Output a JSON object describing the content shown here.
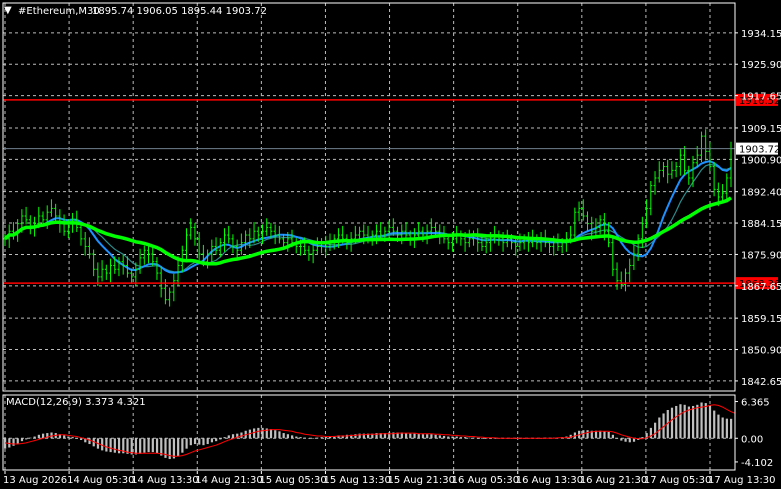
{
  "window": {
    "symbol_label": "#Ethereum,M30",
    "ohlc": "1895.74 1906.05 1895.44 1903.72"
  },
  "colors": {
    "background": "#000000",
    "candle": "#00ff00",
    "grid": "#bcbcbc",
    "axis_text": "#ffffff",
    "level_line": "#ff0000",
    "ma_fast": "#1e90ff",
    "ma_medium": "#2e8b8b",
    "ma_slow": "#00ff00",
    "histogram": "#c0c0c0",
    "signal": "#ff0000",
    "current_price_line": "#708090"
  },
  "chart_data": [
    {
      "type": "candlestick",
      "symbol": "#Ethereum",
      "timeframe": "M30",
      "ylim": [
        1840,
        1942
      ],
      "y_ticks": [
        "1934.15",
        "1925.90",
        "1917.65",
        "1909.15",
        "1900.90",
        "1892.40",
        "1884.15",
        "1875.90",
        "1867.65",
        "1859.15",
        "1850.90",
        "1842.65"
      ],
      "x_ticks": [
        "13 Aug 2026",
        "14 Aug 05:30",
        "14 Aug 13:30",
        "14 Aug 21:30",
        "15 Aug 05:30",
        "15 Aug 13:30",
        "15 Aug 21:30",
        "16 Aug 05:30",
        "16 Aug 13:30",
        "16 Aug 21:30",
        "17 Aug 05:30",
        "17 Aug 13:30"
      ],
      "levels": [
        {
          "value": 1916.52,
          "label": "1916.52"
        },
        {
          "value": 1868.36,
          "label": "1868.36"
        }
      ],
      "current_price": {
        "value": 1903.72,
        "label": "1903.72"
      },
      "close": [
        1880,
        1882,
        1881,
        1884,
        1886,
        1885,
        1883,
        1884,
        1886,
        1885,
        1887,
        1888,
        1886,
        1884,
        1882,
        1884,
        1885,
        1883,
        1880,
        1878,
        1876,
        1872,
        1870,
        1872,
        1871,
        1873,
        1872,
        1874,
        1873,
        1871,
        1870,
        1872,
        1875,
        1877,
        1876,
        1874,
        1871,
        1867,
        1864,
        1866,
        1869,
        1873,
        1877,
        1881,
        1883,
        1880,
        1876,
        1874,
        1876,
        1878,
        1877,
        1879,
        1881,
        1880,
        1878,
        1877,
        1879,
        1881,
        1880,
        1882,
        1881,
        1882,
        1883,
        1882,
        1881,
        1880,
        1879,
        1880,
        1879,
        1878,
        1878,
        1877,
        1876,
        1877,
        1878,
        1879,
        1878,
        1879,
        1880,
        1881,
        1880,
        1879,
        1880,
        1881,
        1882,
        1881,
        1880,
        1881,
        1882,
        1881,
        1882,
        1883,
        1882,
        1881,
        1882,
        1881,
        1880,
        1881,
        1882,
        1881,
        1882,
        1883,
        1882,
        1881,
        1880,
        1879,
        1880,
        1881,
        1880,
        1879,
        1880,
        1881,
        1879,
        1878,
        1879,
        1880,
        1881,
        1880,
        1879,
        1880,
        1879,
        1878,
        1879,
        1880,
        1879,
        1880,
        1879,
        1880,
        1879,
        1878,
        1879,
        1878,
        1879,
        1880,
        1881,
        1887,
        1888,
        1886,
        1884,
        1882,
        1883,
        1885,
        1882,
        1879,
        1872,
        1869,
        1868,
        1871,
        1873,
        1876,
        1880,
        1884,
        1888,
        1894,
        1896,
        1898,
        1899,
        1897,
        1898,
        1899,
        1902,
        1898,
        1896,
        1900,
        1902,
        1907,
        1903,
        1899,
        1893,
        1891,
        1892,
        1896,
        1903.72
      ]
    },
    {
      "type": "macd",
      "label": "MACD(12,26,9) 3.373 4.321",
      "ylim": [
        -5.5,
        7.5
      ],
      "y_ticks": [
        "6.365",
        "0.00",
        "-4.102"
      ],
      "histogram": [
        -1.8,
        -1.6,
        -1.3,
        -0.9,
        -0.5,
        -0.2,
        0.1,
        0.3,
        0.6,
        0.8,
        0.9,
        1.0,
        0.9,
        0.7,
        0.5,
        0.3,
        0.2,
        0.0,
        -0.3,
        -0.7,
        -1.0,
        -1.4,
        -1.8,
        -2.1,
        -2.3,
        -2.4,
        -2.5,
        -2.6,
        -2.6,
        -2.7,
        -2.8,
        -2.8,
        -2.7,
        -2.5,
        -2.4,
        -2.4,
        -2.6,
        -3.0,
        -3.4,
        -3.6,
        -3.5,
        -3.1,
        -2.5,
        -1.8,
        -1.2,
        -1.0,
        -1.1,
        -1.2,
        -1.0,
        -0.7,
        -0.5,
        -0.2,
        0.2,
        0.5,
        0.7,
        0.8,
        1.0,
        1.3,
        1.5,
        1.7,
        1.8,
        1.8,
        1.7,
        1.6,
        1.4,
        1.2,
        0.9,
        0.7,
        0.5,
        0.3,
        0.2,
        0.1,
        0.0,
        0.0,
        0.1,
        0.2,
        0.2,
        0.3,
        0.4,
        0.5,
        0.5,
        0.6,
        0.6,
        0.7,
        0.8,
        0.8,
        0.8,
        0.8,
        0.9,
        0.9,
        0.9,
        1.0,
        1.0,
        1.0,
        1.0,
        0.9,
        0.8,
        0.8,
        0.8,
        0.7,
        0.7,
        0.7,
        0.6,
        0.5,
        0.4,
        0.3,
        0.3,
        0.3,
        0.2,
        0.2,
        0.1,
        0.1,
        0.0,
        -0.1,
        -0.1,
        -0.1,
        0.0,
        0.0,
        0.0,
        0.0,
        0.0,
        -0.1,
        -0.1,
        -0.1,
        0.0,
        0.0,
        0.0,
        0.0,
        0.1,
        0.1,
        0.1,
        0.1,
        0.2,
        0.3,
        0.6,
        1.0,
        1.3,
        1.4,
        1.4,
        1.3,
        1.3,
        1.3,
        1.2,
        1.1,
        0.6,
        0.0,
        -0.4,
        -0.6,
        -0.7,
        -0.6,
        -0.3,
        0.2,
        0.9,
        1.8,
        2.7,
        3.6,
        4.3,
        4.9,
        5.3,
        5.6,
        5.9,
        5.8,
        5.5,
        5.6,
        5.8,
        6.2,
        6.1,
        5.7,
        4.8,
        4.1,
        3.6,
        3.4,
        3.373
      ],
      "signal": [
        -0.8,
        -0.9,
        -1.0,
        -1.0,
        -0.9,
        -0.8,
        -0.6,
        -0.4,
        -0.2,
        0.0,
        0.2,
        0.4,
        0.5,
        0.6,
        0.6,
        0.5,
        0.4,
        0.3,
        0.1,
        -0.1,
        -0.3,
        -0.6,
        -0.9,
        -1.2,
        -1.5,
        -1.7,
        -1.9,
        -2.1,
        -2.2,
        -2.4,
        -2.5,
        -2.6,
        -2.6,
        -2.6,
        -2.6,
        -2.6,
        -2.6,
        -2.7,
        -2.8,
        -3.0,
        -3.1,
        -3.1,
        -3.0,
        -2.8,
        -2.5,
        -2.2,
        -2.0,
        -1.8,
        -1.6,
        -1.4,
        -1.2,
        -0.9,
        -0.6,
        -0.3,
        -0.1,
        0.2,
        0.4,
        0.6,
        0.8,
        1.0,
        1.2,
        1.3,
        1.4,
        1.5,
        1.5,
        1.5,
        1.4,
        1.3,
        1.2,
        1.0,
        0.9,
        0.7,
        0.6,
        0.5,
        0.4,
        0.4,
        0.3,
        0.3,
        0.3,
        0.4,
        0.4,
        0.4,
        0.5,
        0.5,
        0.6,
        0.6,
        0.7,
        0.7,
        0.7,
        0.8,
        0.8,
        0.8,
        0.8,
        0.9,
        0.9,
        0.9,
        0.9,
        0.9,
        0.8,
        0.8,
        0.8,
        0.8,
        0.7,
        0.7,
        0.6,
        0.6,
        0.5,
        0.5,
        0.4,
        0.4,
        0.3,
        0.3,
        0.2,
        0.2,
        0.1,
        0.1,
        0.1,
        0.0,
        0.0,
        0.0,
        0.0,
        0.0,
        0.0,
        0.0,
        0.0,
        0.0,
        0.0,
        0.0,
        0.0,
        0.0,
        0.0,
        0.1,
        0.1,
        0.1,
        0.2,
        0.4,
        0.6,
        0.8,
        1.0,
        1.1,
        1.2,
        1.2,
        1.2,
        1.2,
        1.1,
        0.9,
        0.6,
        0.4,
        0.2,
        0.0,
        -0.1,
        -0.1,
        0.1,
        0.4,
        0.8,
        1.4,
        2.0,
        2.6,
        3.2,
        3.7,
        4.2,
        4.6,
        4.9,
        5.1,
        5.3,
        5.4,
        5.5,
        5.7,
        5.8,
        5.7,
        5.4,
        5.0,
        4.6,
        4.321
      ]
    }
  ]
}
